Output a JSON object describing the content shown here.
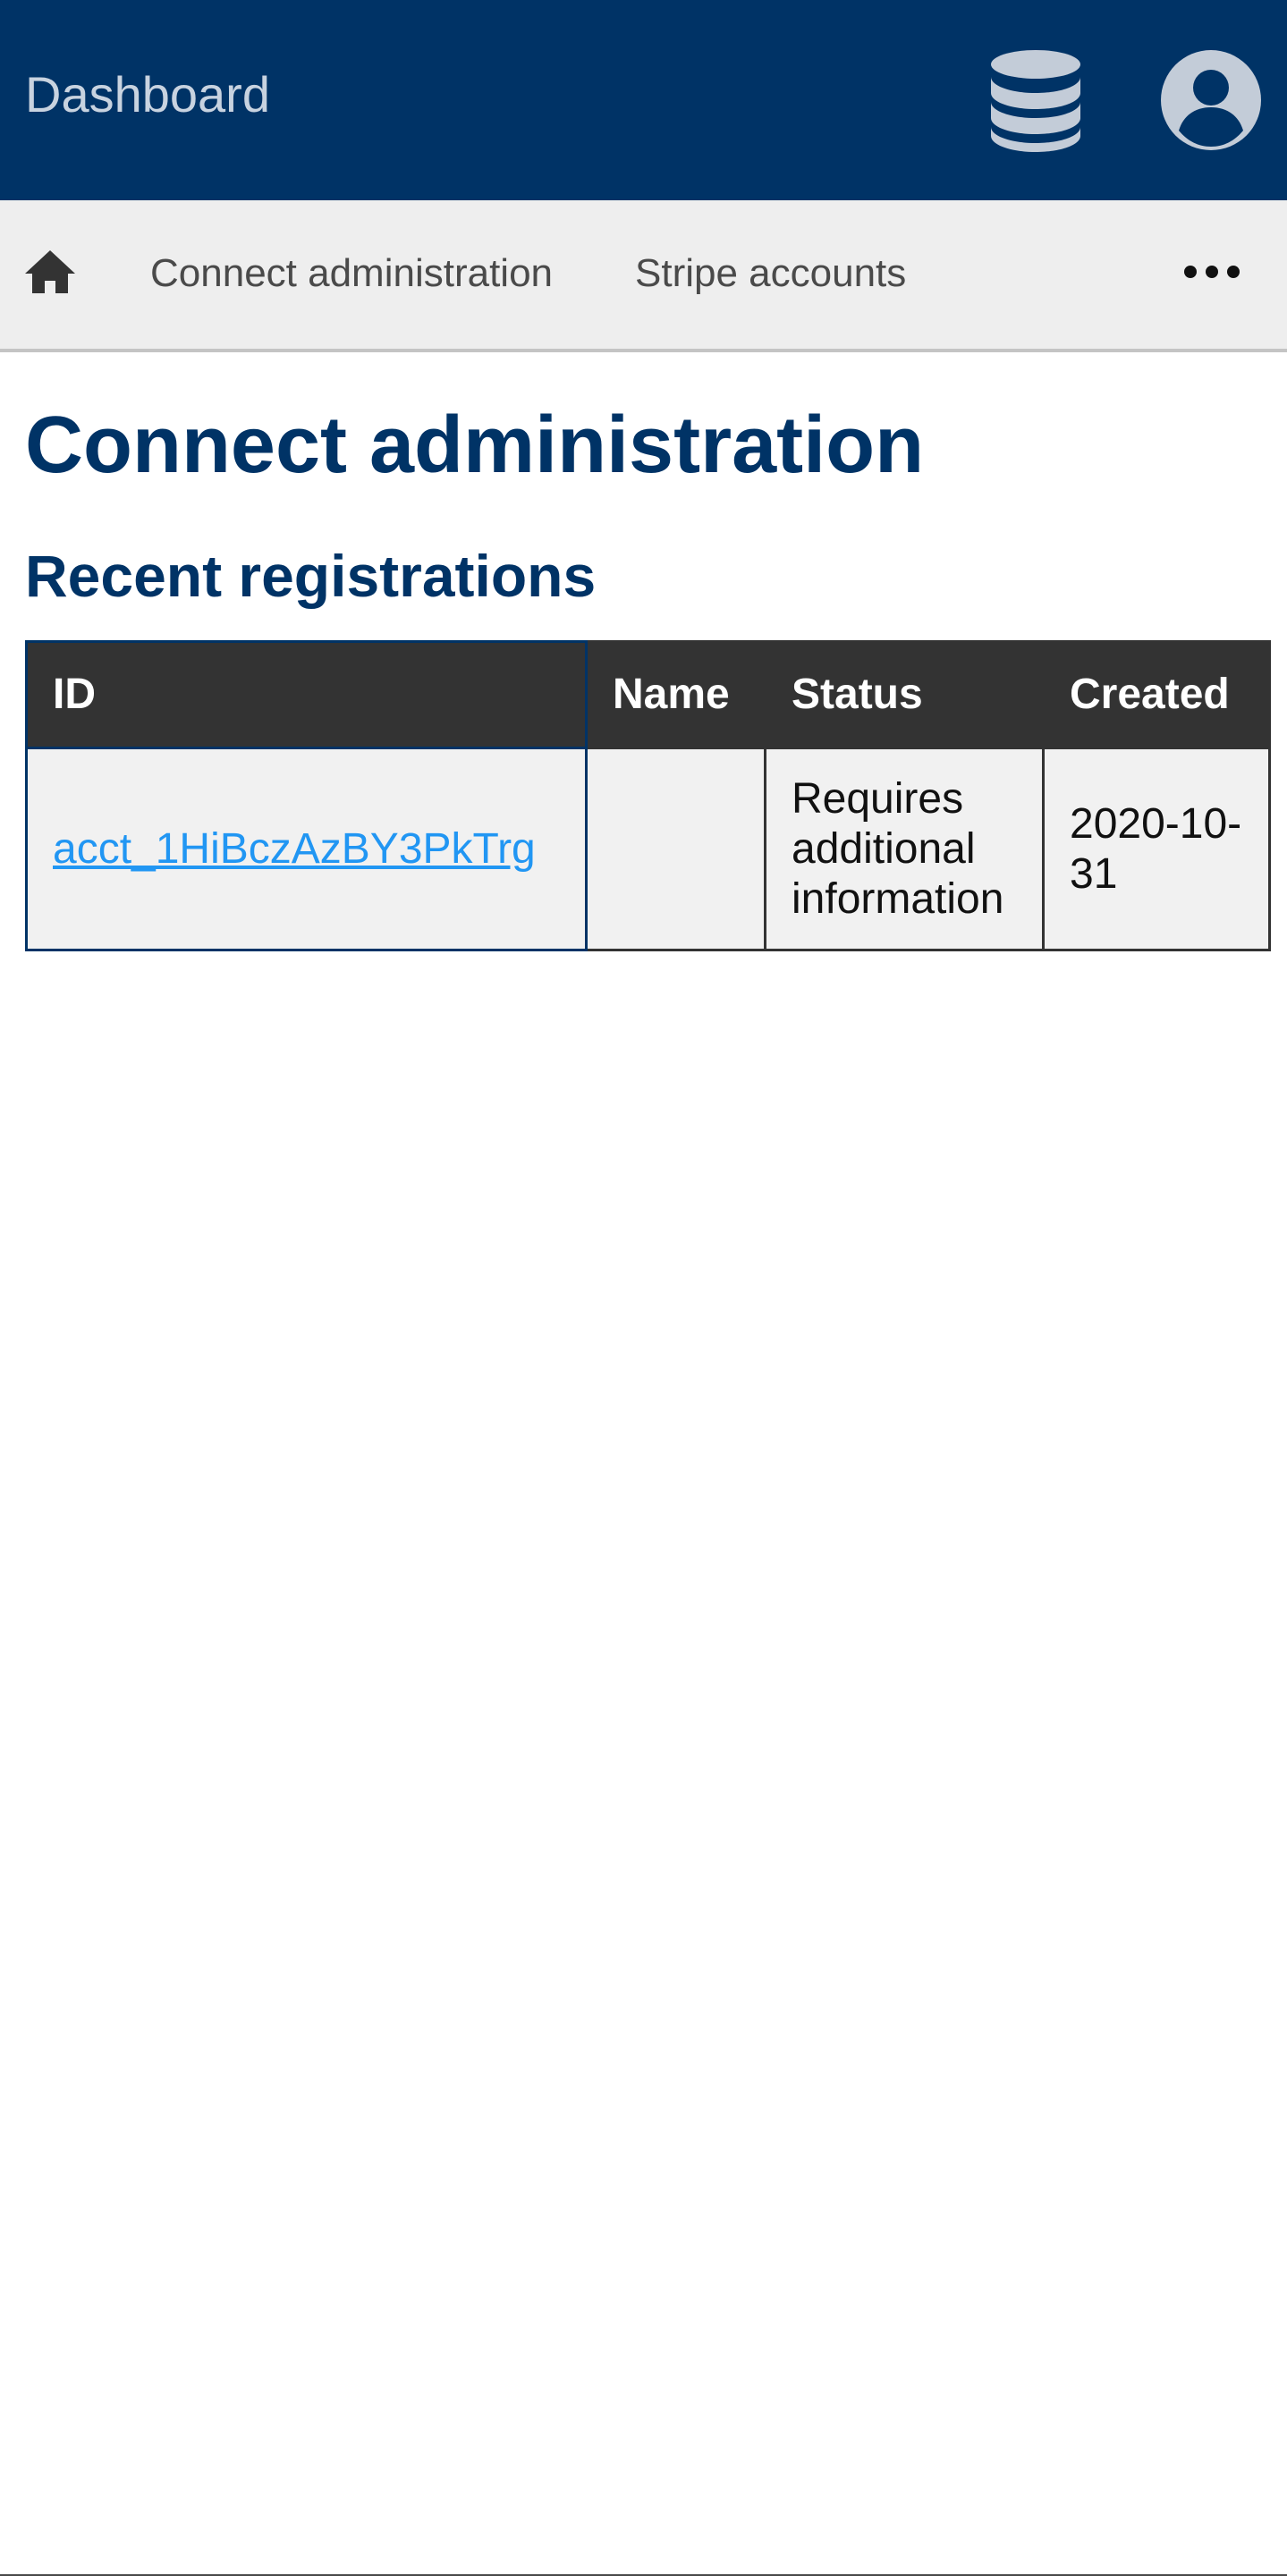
{
  "header": {
    "title": "Dashboard",
    "icons": [
      "database-icon",
      "user-avatar-icon"
    ],
    "background": "#003366"
  },
  "nav": {
    "home_icon": "home-icon",
    "items": [
      {
        "label": "Connect administration"
      },
      {
        "label": "Stripe accounts"
      }
    ],
    "more_icon": "more-horizontal-icon"
  },
  "main": {
    "title": "Connect administration",
    "section_title": "Recent registrations"
  },
  "table": {
    "headers": {
      "id": "ID",
      "name": "Name",
      "status": "Status",
      "created": "Created"
    },
    "rows": [
      {
        "id": "acct_1HiBczAzBY3PkTrg",
        "name": "",
        "status": "Requires additional information",
        "created": "2020-10-31"
      }
    ]
  },
  "colors": {
    "brand": "#003366",
    "link": "#2196f3",
    "table_header": "#333333"
  }
}
